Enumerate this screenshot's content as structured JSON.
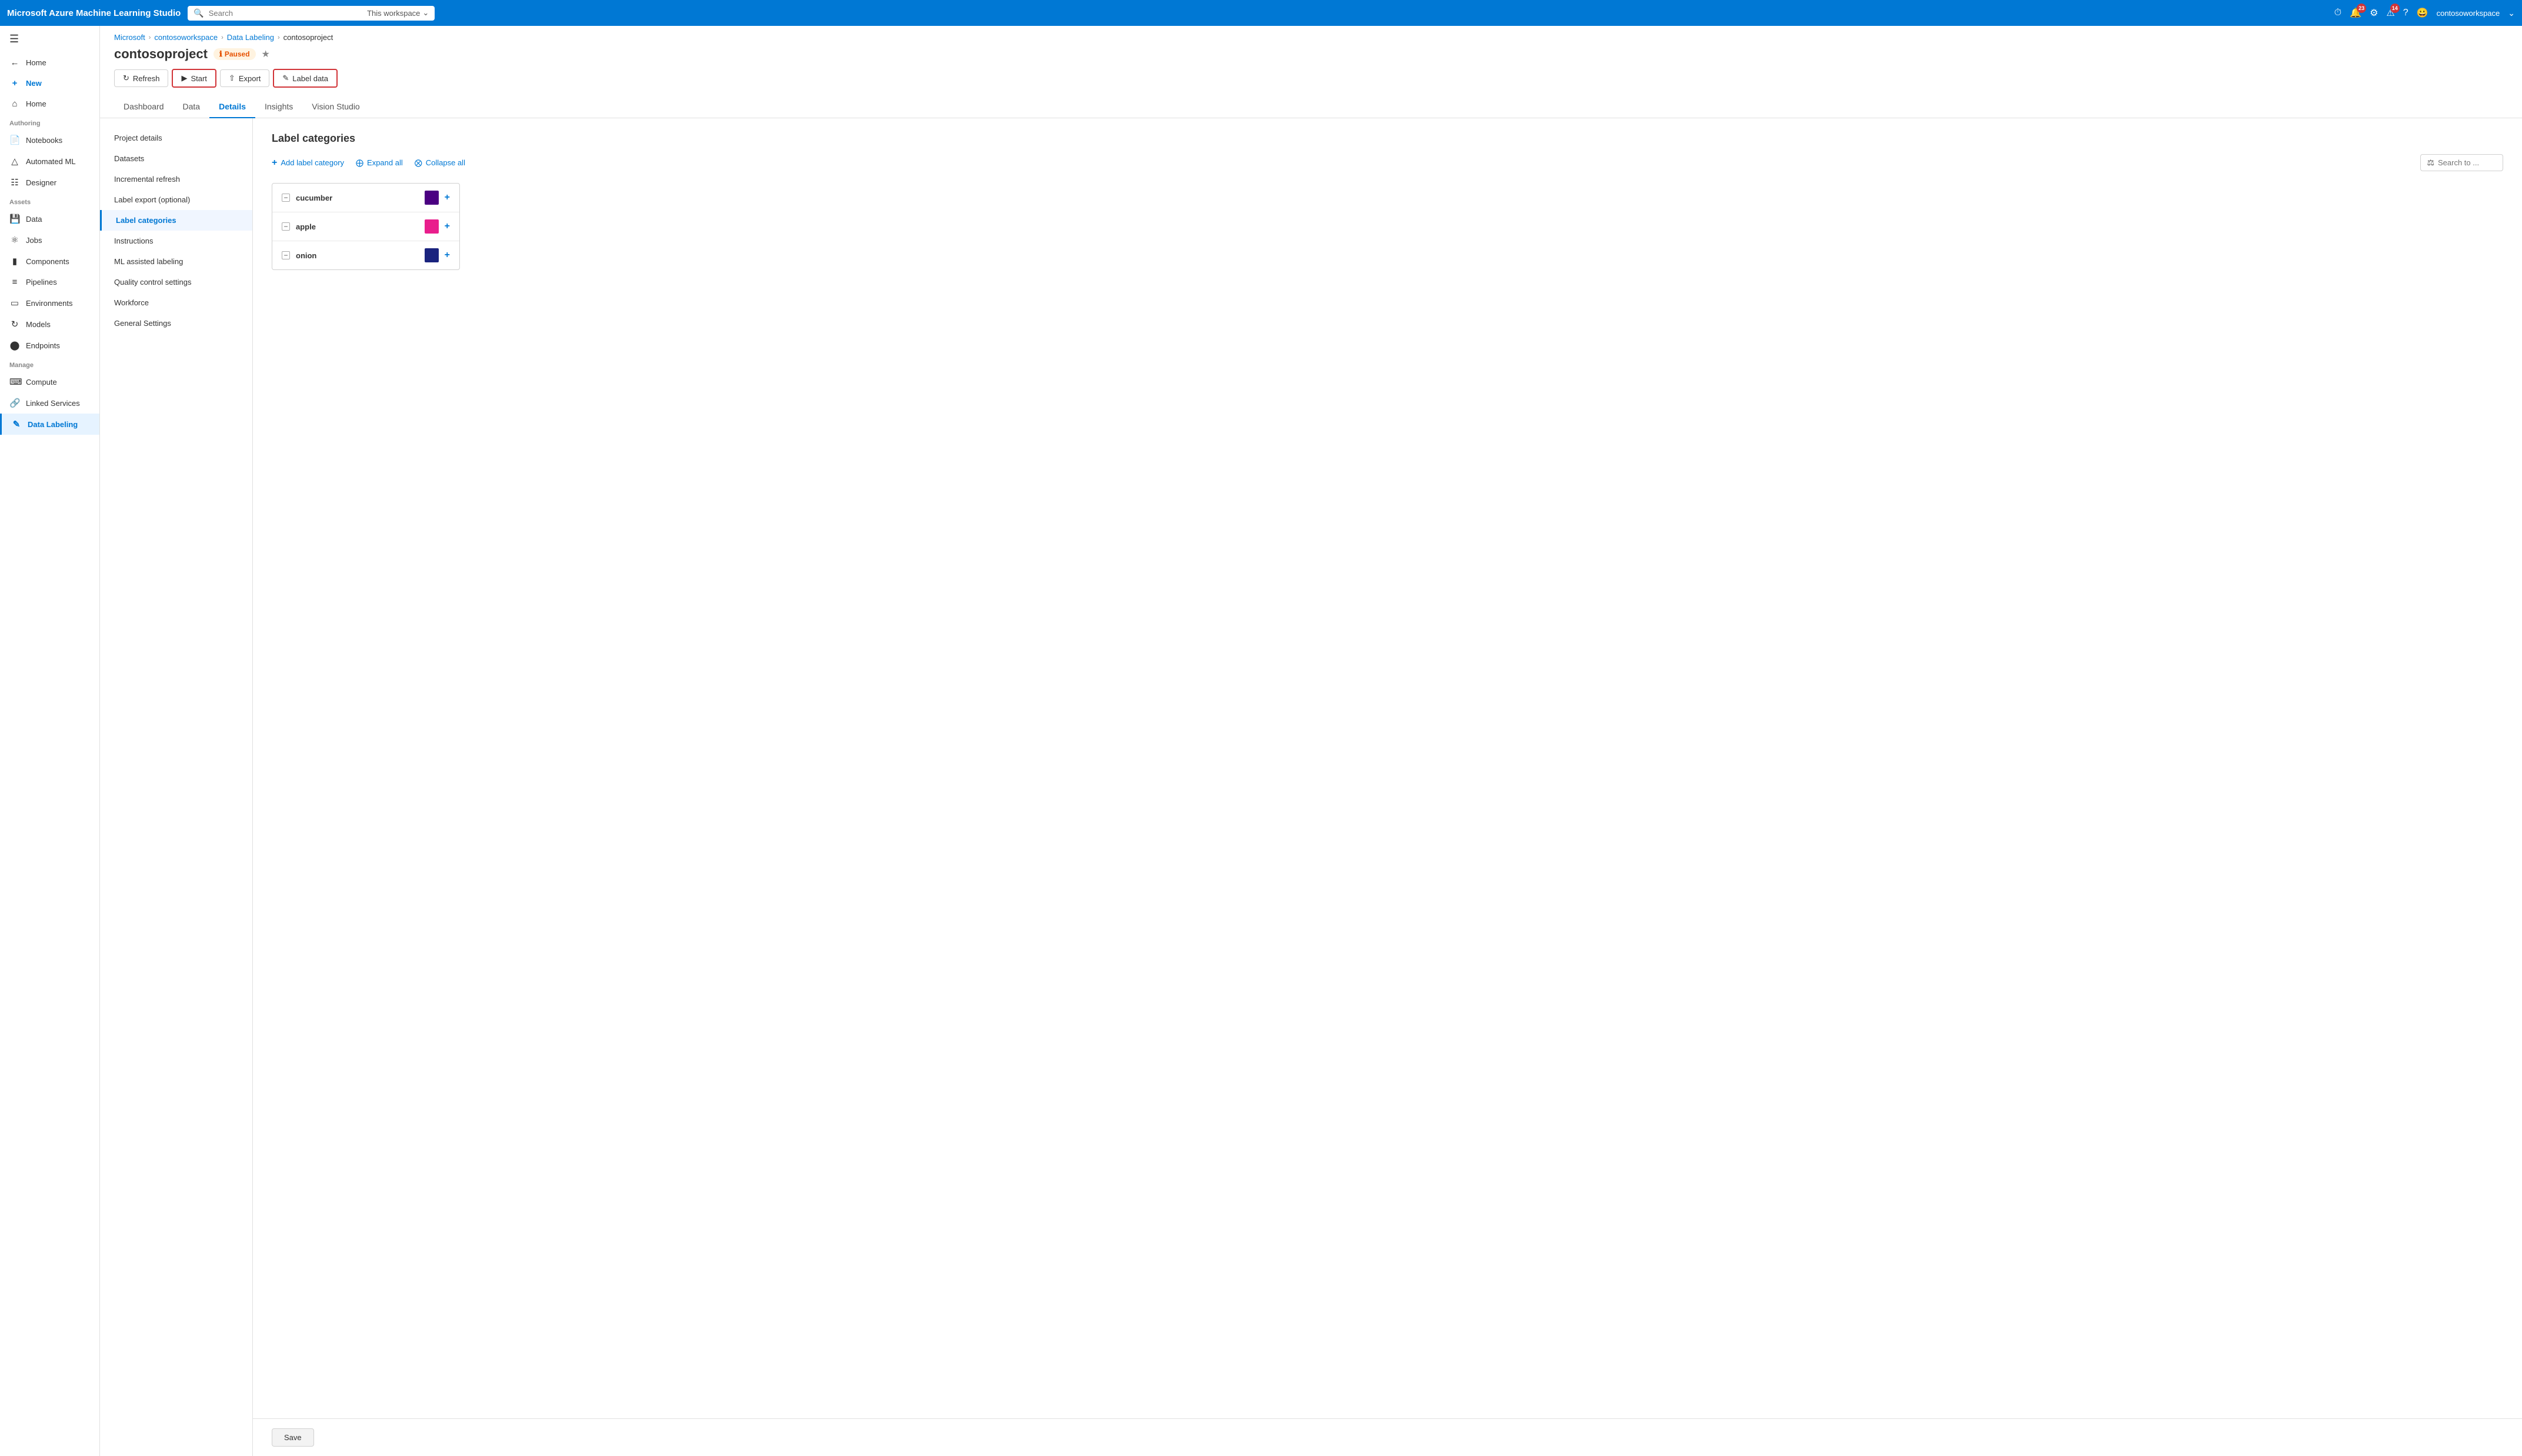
{
  "topbar": {
    "title": "Microsoft Azure Machine Learning Studio",
    "search_placeholder": "Search",
    "workspace_label": "This workspace",
    "notifications_badge": "23",
    "alerts_badge": "14",
    "username": "contosoworkspace"
  },
  "sidebar": {
    "new_label": "New",
    "home_label": "Home",
    "section_authoring": "Authoring",
    "notebooks_label": "Notebooks",
    "automated_ml_label": "Automated ML",
    "designer_label": "Designer",
    "section_assets": "Assets",
    "data_label": "Data",
    "jobs_label": "Jobs",
    "components_label": "Components",
    "pipelines_label": "Pipelines",
    "environments_label": "Environments",
    "models_label": "Models",
    "endpoints_label": "Endpoints",
    "section_manage": "Manage",
    "compute_label": "Compute",
    "linked_services_label": "Linked Services",
    "data_labeling_label": "Data Labeling"
  },
  "breadcrumb": {
    "microsoft": "Microsoft",
    "workspace": "contosoworkspace",
    "data_labeling": "Data Labeling",
    "project": "contosoproject"
  },
  "page_header": {
    "title": "contosoproject",
    "status": "Paused"
  },
  "toolbar": {
    "refresh_label": "Refresh",
    "start_label": "Start",
    "export_label": "Export",
    "label_data_label": "Label data"
  },
  "tabs": [
    {
      "id": "dashboard",
      "label": "Dashboard"
    },
    {
      "id": "data",
      "label": "Data"
    },
    {
      "id": "details",
      "label": "Details",
      "active": true
    },
    {
      "id": "insights",
      "label": "Insights"
    },
    {
      "id": "vision_studio",
      "label": "Vision Studio"
    }
  ],
  "left_nav": [
    {
      "id": "project_details",
      "label": "Project details"
    },
    {
      "id": "datasets",
      "label": "Datasets"
    },
    {
      "id": "incremental_refresh",
      "label": "Incremental refresh"
    },
    {
      "id": "label_export",
      "label": "Label export (optional)"
    },
    {
      "id": "label_categories",
      "label": "Label categories",
      "active": true
    },
    {
      "id": "instructions",
      "label": "Instructions"
    },
    {
      "id": "ml_assisted",
      "label": "ML assisted labeling"
    },
    {
      "id": "quality_control",
      "label": "Quality control settings"
    },
    {
      "id": "workforce",
      "label": "Workforce"
    },
    {
      "id": "general_settings",
      "label": "General Settings"
    }
  ],
  "label_categories": {
    "section_title": "Label categories",
    "add_label_btn": "Add label category",
    "expand_all_btn": "Expand all",
    "collapse_all_btn": "Collapse all",
    "search_placeholder": "Search to ...",
    "categories": [
      {
        "id": "cucumber",
        "name": "cucumber",
        "color": "#4B0082"
      },
      {
        "id": "apple",
        "name": "apple",
        "color": "#E91E8C"
      },
      {
        "id": "onion",
        "name": "onion",
        "color": "#1a237e"
      }
    ]
  },
  "save_bar": {
    "save_label": "Save"
  }
}
